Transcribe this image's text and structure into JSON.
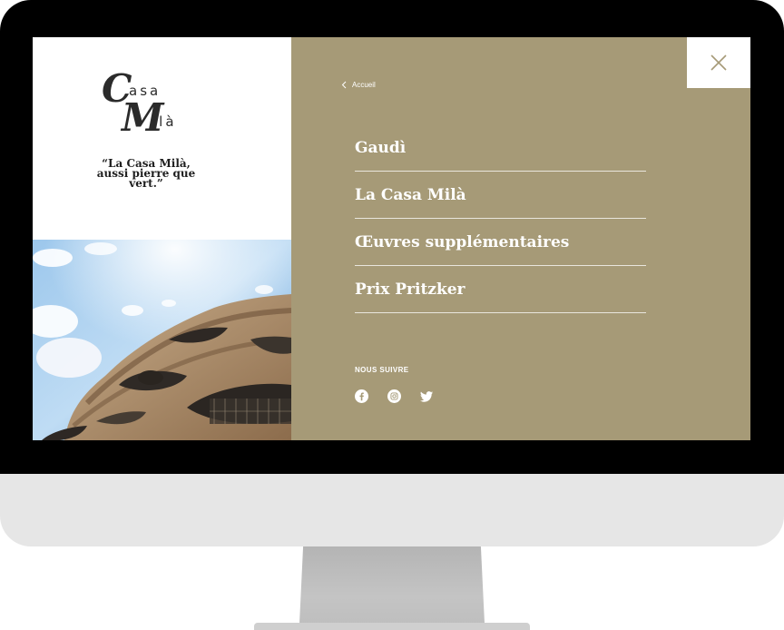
{
  "brand": {
    "logo_line1_initial": "C",
    "logo_line1_rest": "asa",
    "logo_line2_initial": "M",
    "logo_line2_rest": "ilà",
    "quote": "“La Casa Milà, aussi pierre que vert.”"
  },
  "nav": {
    "back_label": "Accueil",
    "items": [
      {
        "label": "Gaudì"
      },
      {
        "label": "La Casa Milà"
      },
      {
        "label": "Œuvres supplémentaires"
      },
      {
        "label": "Prix Pritzker"
      }
    ]
  },
  "follow": {
    "title": "NOUS SUIVRE",
    "networks": [
      "facebook-icon",
      "instagram-icon",
      "twitter-icon"
    ]
  },
  "colors": {
    "menu_background": "#a69a77",
    "text_light": "#ffffff",
    "text_dark": "#1e1e1e"
  }
}
